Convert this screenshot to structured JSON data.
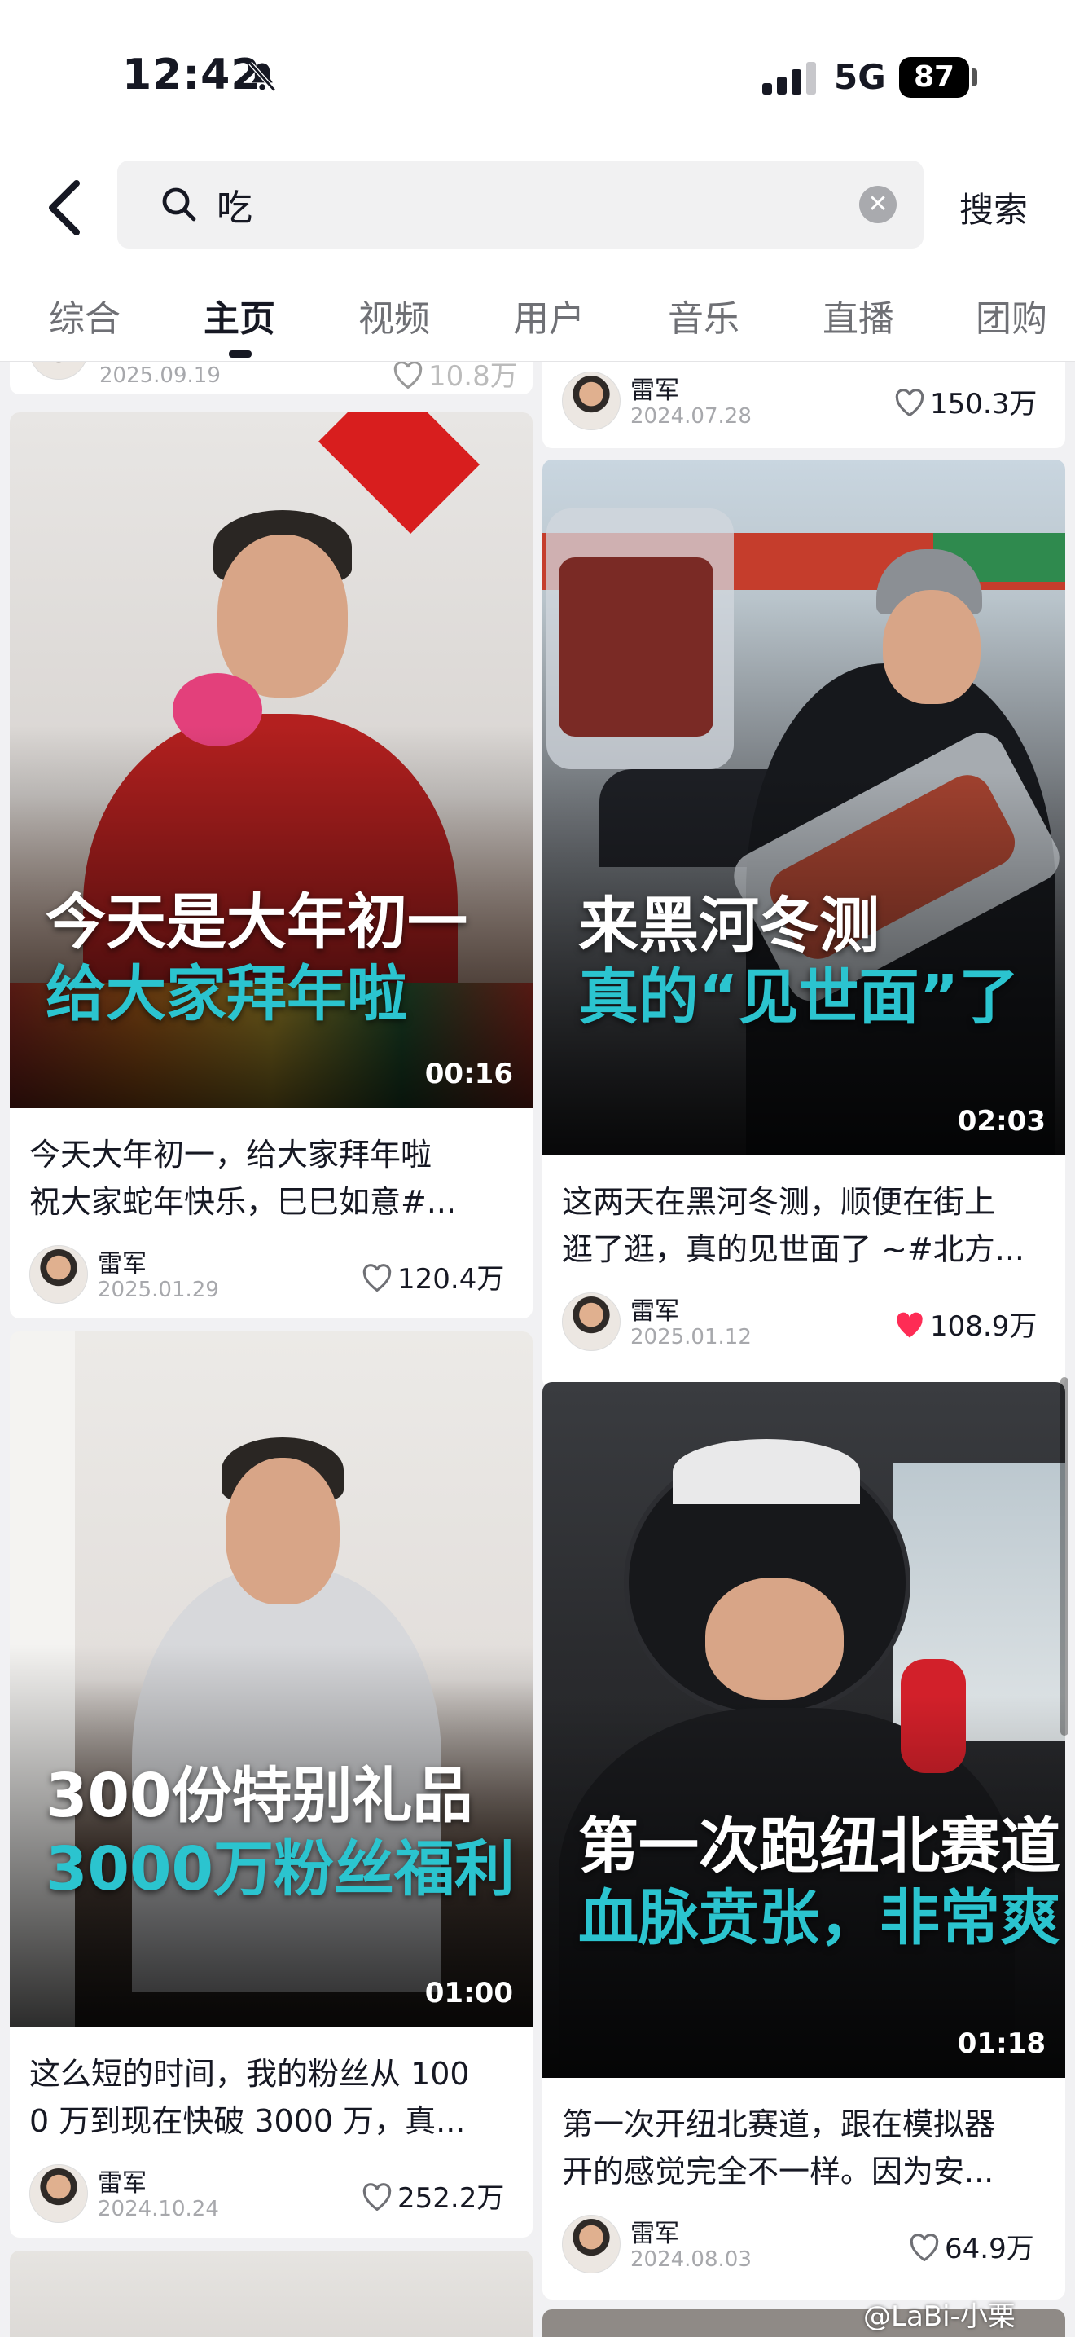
{
  "status_bar": {
    "time": "12:42",
    "network": "5G",
    "battery": "87"
  },
  "search": {
    "query": "吃",
    "button_label": "搜索"
  },
  "tabs": [
    {
      "label": "综合"
    },
    {
      "label": "主页",
      "active": true
    },
    {
      "label": "视频"
    },
    {
      "label": "用户"
    },
    {
      "label": "音乐"
    },
    {
      "label": "直播"
    },
    {
      "label": "团购"
    }
  ],
  "feed": {
    "left_top_partial": {
      "date": "2025.09.19",
      "likes": "10.8万"
    },
    "right_top_partial": {
      "author": "雷军",
      "date": "2024.07.28",
      "likes": "150.3万"
    },
    "cards": [
      {
        "overlay_line1": "今天是大年初一",
        "overlay_line2": "给大家拜年啦",
        "duration": "00:16",
        "desc_line1": "今天大年初一，给大家拜年啦",
        "desc_line2": "祝大家蛇年快乐，巳巳如意#...",
        "author": "雷军",
        "date": "2025.01.29",
        "likes": "120.4万",
        "liked": false
      },
      {
        "overlay_line1": "来黑河冬测",
        "overlay_line2": "真的“见世面”了",
        "duration": "02:03",
        "desc_line1": "这两天在黑河冬测，顺便在街上",
        "desc_line2": "逛了逛，真的见世面了 ~#北方...",
        "author": "雷军",
        "date": "2025.01.12",
        "likes": "108.9万",
        "liked": true
      },
      {
        "overlay_line1": "300份特别礼品",
        "overlay_line2": "3000万粉丝福利",
        "duration": "01:00",
        "desc_line1": "这么短的时间，我的粉丝从 100",
        "desc_line2": "0 万到现在快破 3000 万，真...",
        "author": "雷军",
        "date": "2024.10.24",
        "likes": "252.2万",
        "liked": false
      },
      {
        "overlay_line1": "第一次跑纽北赛道",
        "overlay_line2": "血脉贲张，非常爽!",
        "duration": "01:18",
        "desc_line1": "第一次开纽北赛道，跟在模拟器",
        "desc_line2": "开的感觉完全不一样。因为安...",
        "author": "雷军",
        "date": "2024.08.03",
        "likes": "64.9万",
        "liked": false
      }
    ]
  },
  "watermark": "@LaBi-小栗",
  "colors": {
    "accent_cyan": "#2bc4cf",
    "liked_red": "#fe2c55",
    "text": "#161823",
    "muted": "#a7a8ac"
  },
  "icons": [
    "bell-mute-icon",
    "signal-icon",
    "back-icon",
    "search-icon",
    "clear-icon",
    "heart-icon"
  ]
}
